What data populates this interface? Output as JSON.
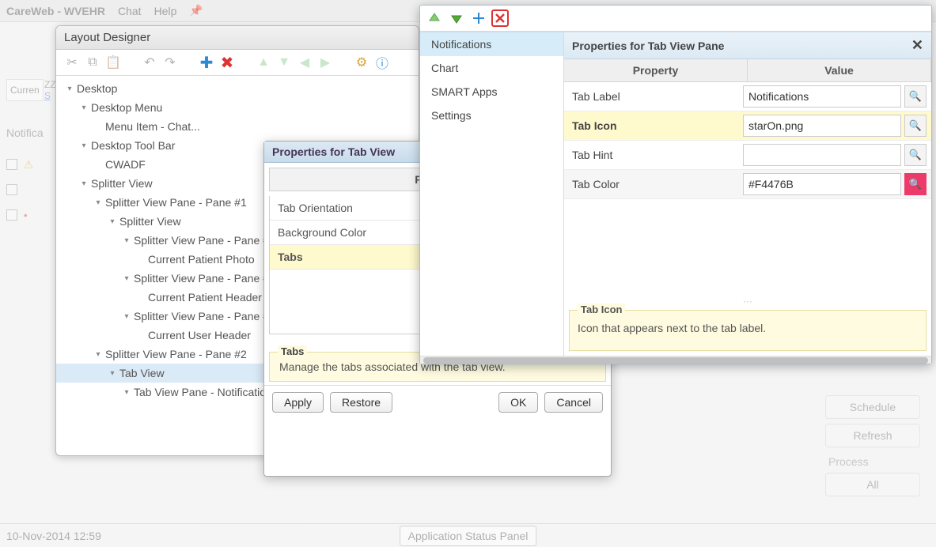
{
  "app": {
    "title": "CareWeb - WVEHR",
    "menu": [
      "Chat",
      "Help"
    ]
  },
  "footer": {
    "timestamp": "10-Nov-2014 12:59",
    "status_panel": "Application Status Panel"
  },
  "right_side": {
    "schedule": "Schedule",
    "refresh": "Refresh",
    "process": "Process",
    "all": "All"
  },
  "bg": {
    "current": "Curren",
    "zz": "ZZ",
    "s": "S",
    "notif_tab": "Notifica"
  },
  "layout_designer": {
    "title": "Layout Designer",
    "tree": [
      {
        "indent": 0,
        "chev": "▾",
        "label": "Desktop"
      },
      {
        "indent": 1,
        "chev": "▾",
        "label": "Desktop Menu"
      },
      {
        "indent": 2,
        "chev": "",
        "label": "Menu Item - Chat..."
      },
      {
        "indent": 1,
        "chev": "▾",
        "label": "Desktop Tool Bar"
      },
      {
        "indent": 2,
        "chev": "",
        "label": "CWADF"
      },
      {
        "indent": 1,
        "chev": "▾",
        "label": "Splitter View"
      },
      {
        "indent": 2,
        "chev": "▾",
        "label": "Splitter View Pane - Pane #1"
      },
      {
        "indent": 3,
        "chev": "▾",
        "label": "Splitter View"
      },
      {
        "indent": 4,
        "chev": "▾",
        "label": "Splitter View Pane - Pane #"
      },
      {
        "indent": 5,
        "chev": "",
        "label": "Current Patient Photo"
      },
      {
        "indent": 4,
        "chev": "▾",
        "label": "Splitter View Pane - Pane #"
      },
      {
        "indent": 5,
        "chev": "",
        "label": "Current Patient Header"
      },
      {
        "indent": 4,
        "chev": "▾",
        "label": "Splitter View Pane - Pane #"
      },
      {
        "indent": 5,
        "chev": "",
        "label": "Current User Header"
      },
      {
        "indent": 2,
        "chev": "▾",
        "label": "Splitter View Pane - Pane #2"
      },
      {
        "indent": 3,
        "chev": "▾",
        "label": "Tab View",
        "sel": true
      },
      {
        "indent": 4,
        "chev": "▾",
        "label": "Tab View Pane - Notificatio"
      }
    ]
  },
  "tabview_panel": {
    "title": "Properties for Tab View",
    "col_header": "Property",
    "rows": [
      {
        "label": "Tab Orientation"
      },
      {
        "label": "Background Color"
      },
      {
        "label": "Tabs",
        "hl": true
      }
    ],
    "hint_title": "Tabs",
    "hint_text": "Manage the tabs associated with the tab view.",
    "buttons": {
      "apply": "Apply",
      "restore": "Restore",
      "ok": "OK",
      "cancel": "Cancel"
    }
  },
  "pane_panel": {
    "title": "Properties for Tab View Pane",
    "left_items": [
      {
        "label": "Notifications",
        "sel": true
      },
      {
        "label": "Chart"
      },
      {
        "label": "SMART Apps"
      },
      {
        "label": "Settings"
      }
    ],
    "headers": {
      "prop": "Property",
      "val": "Value"
    },
    "rows": [
      {
        "label": "Tab Label",
        "value": "Notifications"
      },
      {
        "label": "Tab Icon",
        "value": "starOn.png",
        "hl": true
      },
      {
        "label": "Tab Hint",
        "value": ""
      },
      {
        "label": "Tab Color",
        "value": "#F4476B",
        "pink": true,
        "alt": true
      }
    ],
    "hint_title": "Tab Icon",
    "hint_text": "Icon that appears next to the tab label."
  }
}
